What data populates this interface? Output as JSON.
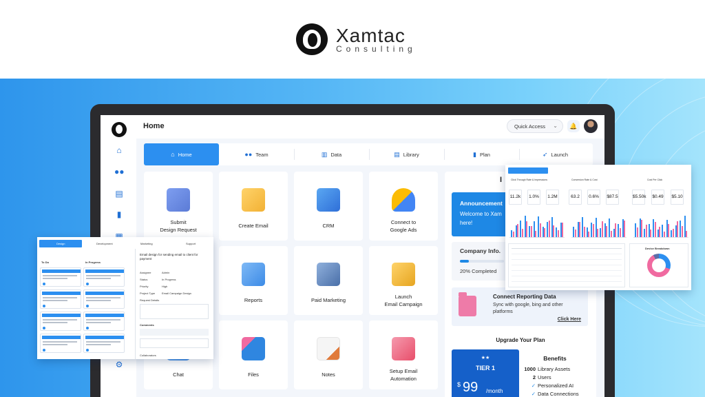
{
  "brand": {
    "name": "Xamtac",
    "sub": "Consulting"
  },
  "app": {
    "page_title": "Home",
    "quick_access": "Quick Access",
    "tabs": [
      {
        "label": "Home",
        "icon": "home-icon"
      },
      {
        "label": "Team",
        "icon": "team-icon"
      },
      {
        "label": "Data",
        "icon": "chart-icon"
      },
      {
        "label": "Library",
        "icon": "library-icon"
      },
      {
        "label": "Plan",
        "icon": "plan-icon"
      },
      {
        "label": "Launch",
        "icon": "rocket-icon"
      }
    ],
    "tiles": [
      {
        "label": "Submit Design Request",
        "l1": "Submit",
        "l2": "Design Request",
        "color": "#5b7bd6"
      },
      {
        "label": "Create Email",
        "l1": "Create Email",
        "l2": "",
        "color": "#f2b134"
      },
      {
        "label": "CRM",
        "l1": "CRM",
        "l2": "",
        "color": "#2f6fd8"
      },
      {
        "label": "Connect to Google Ads",
        "l1": "Connect to",
        "l2": "Google Ads",
        "color": "#fbbc04"
      },
      {
        "label": "Reports",
        "l1": "Reports",
        "l2": "",
        "color": "#3c8be6"
      },
      {
        "label": "Paid Marketing",
        "l1": "Paid Marketing",
        "l2": "",
        "color": "#4a6fa8"
      },
      {
        "label": "Launch Email Campaign",
        "l1": "Launch",
        "l2": "Email Campaign",
        "color": "#e6a520"
      },
      {
        "label": "Chat",
        "l1": "Chat",
        "l2": "",
        "color": "#3c8be6"
      },
      {
        "label": "Files",
        "l1": "Files",
        "l2": "",
        "color": "#2f86e0"
      },
      {
        "label": "Notes",
        "l1": "Notes",
        "l2": "",
        "color": "#e07a3a"
      },
      {
        "label": "Setup Email Automation",
        "l1": "Setup Email",
        "l2": "Automation",
        "color": "#e84e6a"
      }
    ],
    "panel": {
      "heading_partial": "I",
      "announcement_title": "Announcement",
      "announcement_text": "Welcome to Xam here!",
      "company_info_title": "Company Info.",
      "progress_percent": 20,
      "progress_text": "20% Completed",
      "reporting_title": "Connect Reporting Data",
      "reporting_text": "Sync with google, bing and other platforms",
      "reporting_link": "Click Here",
      "upgrade_title": "Upgrade Your Plan",
      "tier_stars": "★★",
      "tier_name": "TIER 1",
      "tier_currency": "$",
      "tier_price": "99",
      "tier_period": "/month",
      "benefits_title": "Benefits",
      "benefits": [
        {
          "n": "1000",
          "t": "Library Assets"
        },
        {
          "n": "2",
          "t": "Users"
        },
        {
          "n": "✓",
          "t": "Personalized AI"
        },
        {
          "n": "✓",
          "t": "Data Connections"
        }
      ]
    }
  },
  "overlay_task": {
    "tabs": [
      "Design",
      "Development",
      "Marketing",
      "Support"
    ],
    "columns": [
      "To Do",
      "In Progress"
    ],
    "detail_title": "Email design for sending email to client for payment",
    "fields": [
      "Assignee",
      "Status",
      "Priority",
      "Project Type",
      "Request Details"
    ],
    "values": [
      "Admin",
      "In Progress",
      "High",
      "Email Campaign Design"
    ],
    "comments_label": "Comments",
    "collaborators_label": "Collaborators"
  },
  "overlay_report": {
    "kpi_titles": [
      "Click Through Rate & Impressions",
      "Conversion Rate & Cost",
      "Cost Per Click"
    ],
    "kpis": [
      "11.2k",
      "1.0%",
      "1.2M",
      "63.2",
      "0.6%",
      "$87.5",
      "$5.50k",
      "$0.49",
      "$5.10"
    ],
    "donut_title": "Device Breakdown"
  },
  "colors": {
    "accent": "#2c8ff0",
    "brand_blue": "#1560c9",
    "pink": "#ee7ba8"
  }
}
